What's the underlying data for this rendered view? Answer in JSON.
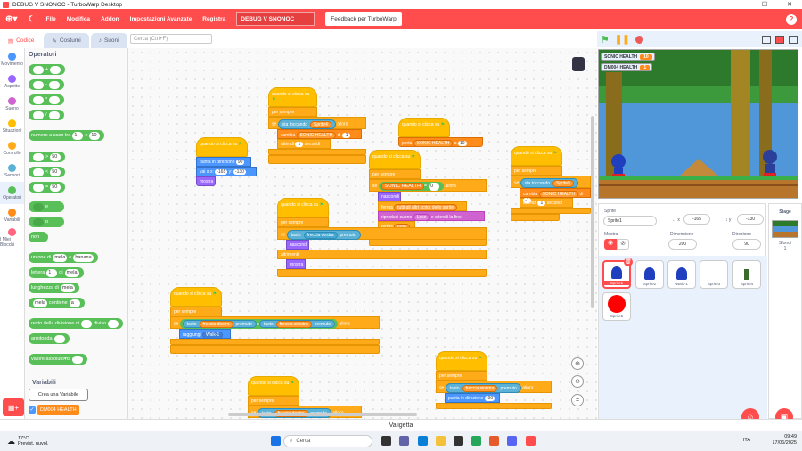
{
  "window": {
    "title": "DEBUG V SNONOC - TurboWarp Desktop",
    "controls": [
      "—",
      "☐",
      "✕"
    ]
  },
  "menu": {
    "items": [
      "File",
      "Modifica",
      "Addon",
      "Impostazioni Avanzate",
      "Registra"
    ],
    "project_title": "DEBUG V SNONOC",
    "feedback": "Feedback per TurboWarp"
  },
  "tabs": [
    {
      "label": "Codice"
    },
    {
      "label": "Costumi"
    },
    {
      "label": "Suoni"
    }
  ],
  "search": {
    "placeholder": "Cerca (Ctrl+F)"
  },
  "categories": [
    {
      "label": "Movimento",
      "color": "#4c97ff"
    },
    {
      "label": "Aspetto",
      "color": "#9966ff"
    },
    {
      "label": "Suono",
      "color": "#cf63cf"
    },
    {
      "label": "Situazioni",
      "color": "#ffbf00"
    },
    {
      "label": "Controllo",
      "color": "#ffab19"
    },
    {
      "label": "Sensori",
      "color": "#5cb1d6"
    },
    {
      "label": "Operatori",
      "color": "#59c059"
    },
    {
      "label": "Variabili",
      "color": "#ff8c1a"
    },
    {
      "label": "I Miei Blocchi",
      "color": "#ff6680"
    }
  ],
  "palette": {
    "title": "Operatori",
    "pick_random": {
      "a": "numero a caso tra",
      "v1": "1",
      "b": "e",
      "v2": "10"
    },
    "compare_val": "50",
    "and": "e",
    "or": "o",
    "not": "non",
    "join": {
      "a": "unione di",
      "v1": "mela",
      "b": "e",
      "v2": "banana"
    },
    "letter": {
      "a": "lettera",
      "v1": "1",
      "b": "di",
      "v2": "mela"
    },
    "length": {
      "a": "lunghezza di",
      "v1": "mela"
    },
    "contains": {
      "v1": "mela",
      "a": "contiene",
      "v2": "a"
    },
    "mod": {
      "a": "resto della divisione di",
      "b": "diviso"
    },
    "round": "arrotonda",
    "math": {
      "a": "valore assoluto",
      "b": "di"
    },
    "variables_title": "Variabili",
    "make_variable": "Crea una Variabile",
    "var_name": "DM004 HEALTH"
  },
  "scripts": {
    "hat": "quando si clicca su",
    "forever": "per sempre",
    "if": "se",
    "then": "allora",
    "s1": {
      "touching": "sta toccando",
      "sprite": "Sprite4",
      "change": "cambia",
      "var": "SONIC HEALTH",
      "by": "di",
      "val": "-1",
      "wait": "attendi",
      "secs": "1",
      "seconds": "secondi"
    },
    "s2": {
      "point": "punta in direzione",
      "dir": "90",
      "goto": "vai a x:",
      "x": "-165",
      "y_label": "y:",
      "y": "-130",
      "show": "mostra"
    },
    "s3": {
      "set": "porta",
      "var": "SONIC HEALTH",
      "to": "a",
      "val": "10"
    },
    "s4": {
      "var": "SONIC HEALTH",
      "eq": "=",
      "val": "0",
      "hide": "nascondi",
      "stop": "ferma",
      "stop_opt": "tutti gli altri script dello sprite",
      "play": "riproduci suono",
      "sound": "Lose",
      "until": "e attendi la fine",
      "stop2": "tutto"
    },
    "s5": {
      "key": "tasto",
      "right": "freccia destra",
      "pressed": "premuto",
      "hide": "nascondi",
      "else": "altrimenti",
      "show": "mostra"
    },
    "s6": {
      "key": "tasto",
      "right": "freccia destra",
      "pressed": "premuto",
      "or": "o",
      "left": "freccia sinistra",
      "reach": "raggiungi",
      "target": "Walk-1"
    },
    "s7": {
      "touching": "sta toccando",
      "sprite": "Sprite5",
      "change": "cambia",
      "var": "SONIC HEALTH",
      "by": "di",
      "val": "-1",
      "wait": "attendi",
      "secs": "1",
      "seconds": "secondi"
    },
    "s8": {
      "key": "tasto",
      "left": "freccia sinistra",
      "pressed": "premuto",
      "point": "punta in direzione",
      "dir": "-90"
    }
  },
  "stage": {
    "monitors": [
      {
        "label": "SONIC HEALTH",
        "value": "10"
      },
      {
        "label": "DM004 HEALTH",
        "value": "1"
      }
    ]
  },
  "sprite_info": {
    "label": "Sprite",
    "name": "Sprite1",
    "x": "-165",
    "y": "-130",
    "show_label": "Mostra",
    "size_label": "Dimensione",
    "size": "200",
    "dir_label": "Direzione",
    "dir": "90",
    "sprites": [
      "Sprite1",
      "Sprite2",
      "Walk-1",
      "Sprite3",
      "Sprite4",
      "Sprite5"
    ]
  },
  "stage_panel": {
    "title": "Stage",
    "backdrops_label": "Sfondi",
    "backdrops": "1"
  },
  "backpack": "Valigetta",
  "taskbar": {
    "temp": "17°C",
    "weather": "Previst. nuvol.",
    "search": "Cerca",
    "lang": "ITA",
    "time": "09:49",
    "date": "17/06/2025"
  }
}
